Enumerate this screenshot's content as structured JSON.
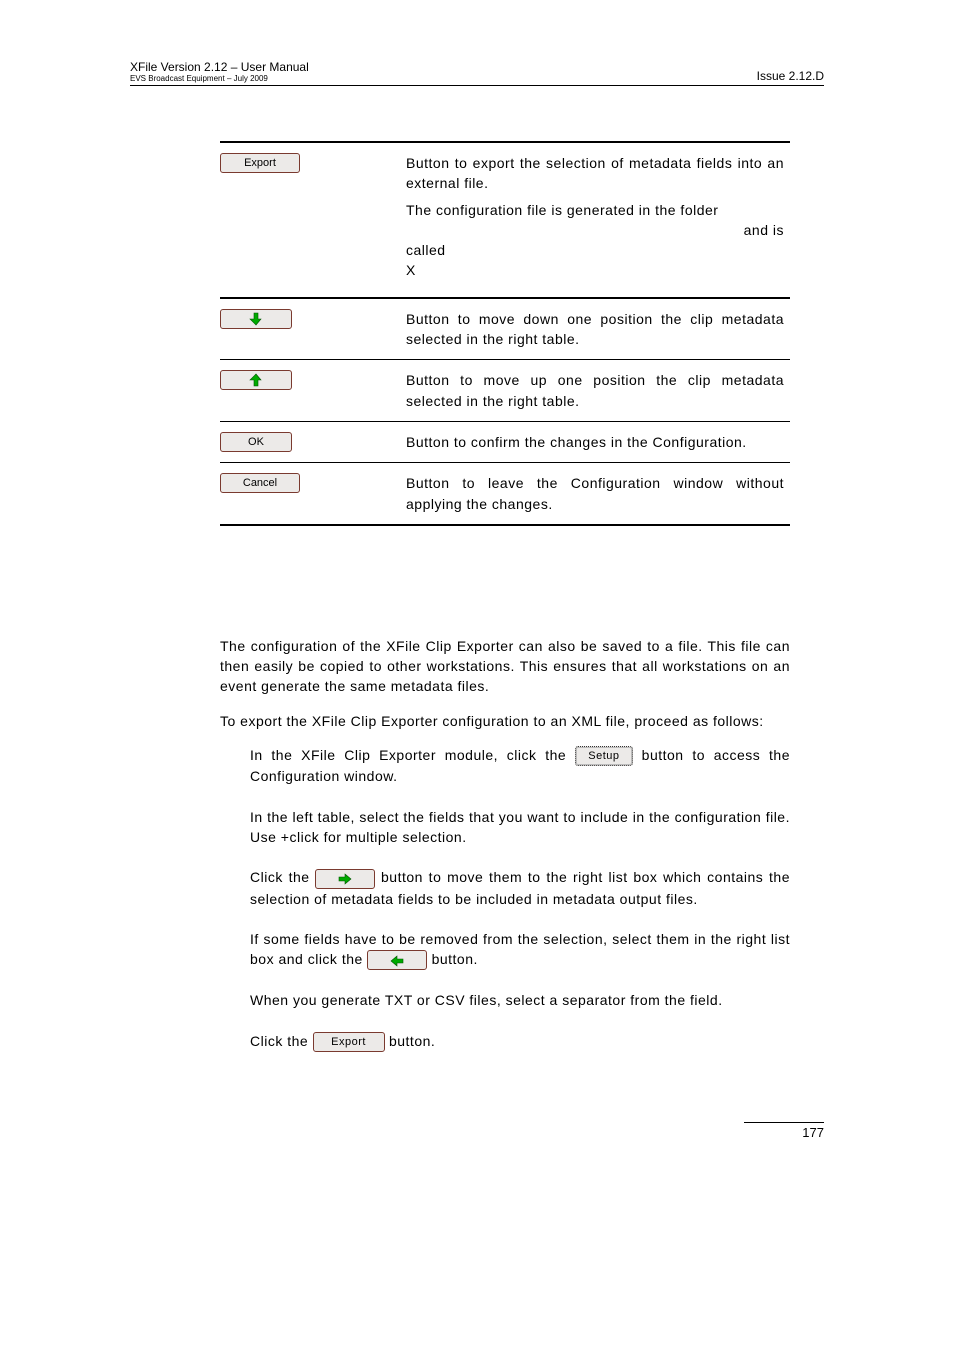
{
  "header": {
    "left_top": "XFile Version 2.12 – User Manual",
    "left_bottom": "EVS Broadcast Equipment – July 2009",
    "right": "Issue 2.12.D"
  },
  "buttons": {
    "export": "Export",
    "ok": "OK",
    "cancel": "Cancel",
    "setup": "Setup"
  },
  "table": {
    "export": {
      "p1": "Button to export the selection of metadata fields into an external file.",
      "p2": "The configuration file is generated in the folder",
      "p3_right": "and is",
      "p4a": "called",
      "p4b": "X"
    },
    "down": "Button to move down one position the clip metadata selected in the right table.",
    "up": "Button to move up one position the clip metadata selected in the right table.",
    "ok": "Button to confirm the changes in the Configuration.",
    "cancel": "Button to leave the Configuration window without applying the changes."
  },
  "body": {
    "p1": "The configuration of the XFile Clip Exporter can also be saved to a file. This file can then easily be copied to other workstations. This ensures that all workstations on an event generate the same metadata files.",
    "p2": "To export the XFile Clip Exporter configuration to an XML file, proceed as follows:"
  },
  "steps": {
    "s1a": "In the XFile Clip Exporter module, click the ",
    "s1b": " button to access the Configuration window.",
    "s2a": "In the left table, select the fields that you want to include in the configuration file. Use ",
    "s2b": "+click for multiple selection.",
    "s3a": "Click the ",
    "s3b": " button to move them to the right list box which contains the selection of metadata fields to be included in metadata output files.",
    "s4a": "If some fields have to be removed from the selection, select them in the right list box and click the ",
    "s4b": " button.",
    "s5a": "When you generate TXT or CSV files, select a separator from the ",
    "s5b": " field.",
    "s6a": "Click the ",
    "s6b": " button."
  },
  "page_number": "177"
}
